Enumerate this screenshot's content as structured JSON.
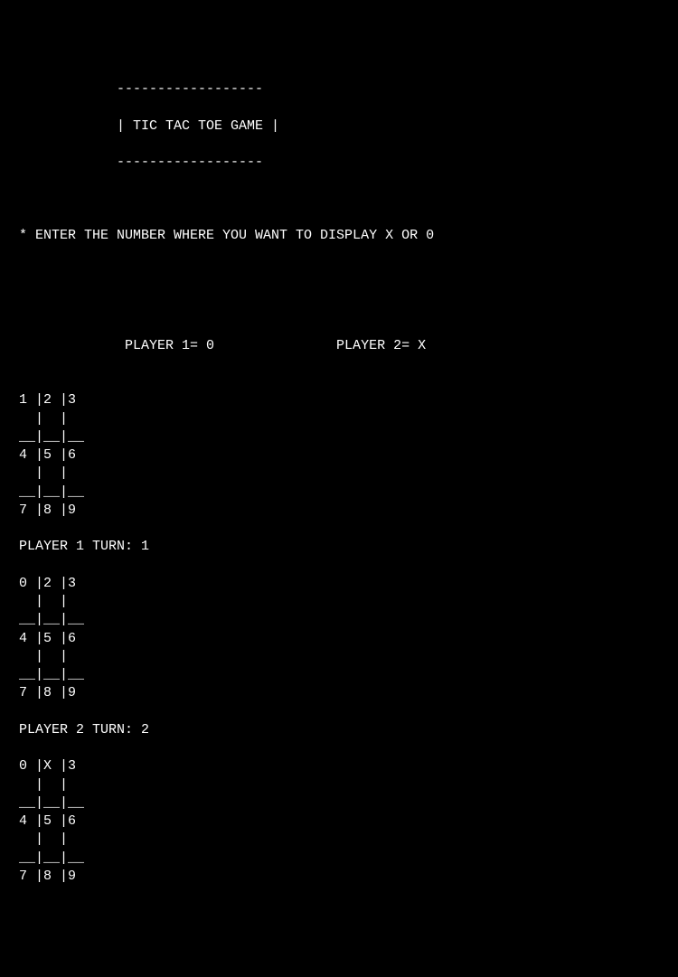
{
  "title_border": "             ------------------",
  "title_line": "             | TIC TAC TOE GAME |",
  "instruction": " * ENTER THE NUMBER WHERE YOU WANT TO DISPLAY X OR 0",
  "players_line": "              PLAYER 1= 0               PLAYER 2= X",
  "boards": [
    {
      "turn_label": "",
      "cells": [
        "1",
        "2",
        "3",
        "4",
        "5",
        "6",
        "7",
        "8",
        "9"
      ]
    },
    {
      "turn_label": " PLAYER 1 TURN: 1",
      "cells": [
        "0",
        "2",
        "3",
        "4",
        "5",
        "6",
        "7",
        "8",
        "9"
      ]
    },
    {
      "turn_label": " PLAYER 2 TURN: 2",
      "cells": [
        "0",
        "X",
        "3",
        "4",
        "5",
        "6",
        "7",
        "8",
        "9"
      ]
    }
  ]
}
